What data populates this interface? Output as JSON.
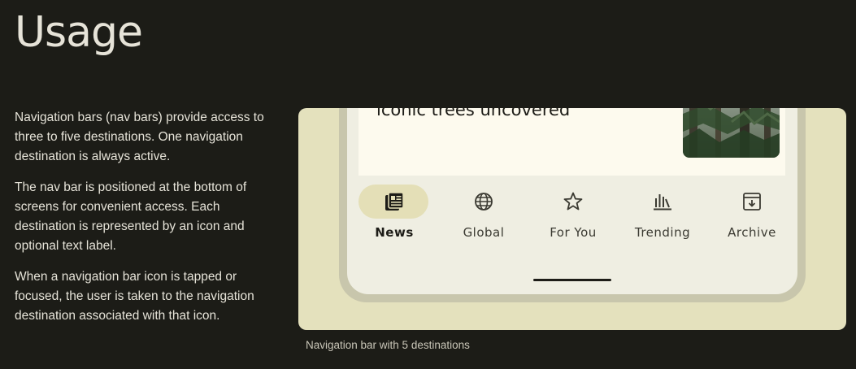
{
  "page": {
    "title": "Usage",
    "paragraphs": [
      "Navigation bars (nav bars) provide access to three to five destinations. One navigation destination is always active.",
      "The nav bar is positioned at the bottom of screens for convenient access. Each destination is represented by an icon and optional text label.",
      "When a navigation bar icon is tapped or focused, the user is taken to the navigation destination associated with that icon."
    ]
  },
  "figure": {
    "caption": "Navigation bar with 5 destinations",
    "card": {
      "title": "Genetic code for California’s iconic trees uncovered",
      "thumbnail_icon": "forest-photo"
    },
    "nav_items": [
      {
        "label": "News",
        "icon": "newspaper-icon",
        "active": true
      },
      {
        "label": "Global",
        "icon": "globe-icon",
        "active": false
      },
      {
        "label": "For You",
        "icon": "star-icon",
        "active": false
      },
      {
        "label": "Trending",
        "icon": "trending-bars-icon",
        "active": false
      },
      {
        "label": "Archive",
        "icon": "archive-icon",
        "active": false
      }
    ]
  },
  "colors": {
    "background": "#1c1c17",
    "text": "#e6e3d8",
    "figure_bg": "#e4e1bd",
    "active_pill": "#e4dfb7",
    "card_bg": "#fdfaee"
  }
}
